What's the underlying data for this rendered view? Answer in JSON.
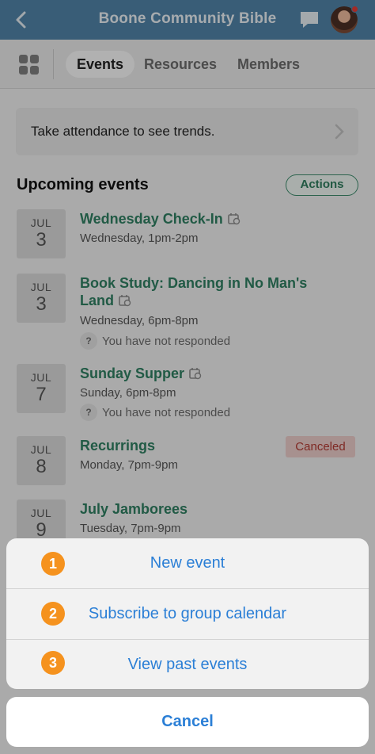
{
  "header": {
    "title": "Boone Community Bible"
  },
  "tabs": [
    {
      "label": "Events"
    },
    {
      "label": "Resources"
    },
    {
      "label": "Members"
    }
  ],
  "attendance_banner": "Take attendance to see trends.",
  "section_title": "Upcoming events",
  "actions_label": "Actions",
  "events": [
    {
      "month": "JUL",
      "day": "3",
      "title": "Wednesday Check-In",
      "time": "Wednesday, 1pm-2pm",
      "recurring": true
    },
    {
      "month": "JUL",
      "day": "3",
      "title": "Book Study: Dancing in No Man's Land",
      "time": "Wednesday, 6pm-8pm",
      "response": "You have not responded",
      "recurring": true
    },
    {
      "month": "JUL",
      "day": "7",
      "title": "Sunday Supper",
      "time": "Sunday, 6pm-8pm",
      "response": "You have not responded",
      "recurring": true
    },
    {
      "month": "JUL",
      "day": "8",
      "title": "Recurrings",
      "time": "Monday, 7pm-9pm",
      "status": "Canceled"
    },
    {
      "month": "JUL",
      "day": "9",
      "title": "July Jamborees",
      "time": "Tuesday, 7pm-9pm"
    }
  ],
  "response_icon": "?",
  "action_sheet": {
    "items": [
      {
        "badge": "1",
        "label": "New event"
      },
      {
        "badge": "2",
        "label": "Subscribe to group calendar"
      },
      {
        "badge": "3",
        "label": "View past events"
      }
    ],
    "cancel": "Cancel"
  },
  "colors": {
    "header": "#4f82a6",
    "event_title": "#2e7d60",
    "action_text": "#2b7fd6",
    "badge": "#f5921e",
    "canceled": "#b03a32"
  }
}
